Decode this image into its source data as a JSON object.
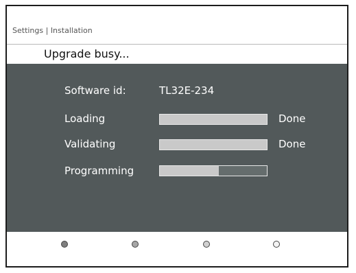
{
  "breadcrumb": "Settings | Installation",
  "title": "Upgrade busy...",
  "software_id": {
    "label": "Software id:",
    "value": "TL32E-234"
  },
  "steps": [
    {
      "label": "Loading",
      "progress": 1.0,
      "status": "Done"
    },
    {
      "label": "Validating",
      "progress": 1.0,
      "status": "Done"
    },
    {
      "label": "Programming",
      "progress": 0.55,
      "status": ""
    }
  ],
  "color_keys": [
    {
      "name": "red-key-icon",
      "fill": "#7f7f7f"
    },
    {
      "name": "green-key-icon",
      "fill": "#a6a6a6"
    },
    {
      "name": "yellow-key-icon",
      "fill": "#d0d0d0"
    },
    {
      "name": "blue-key-icon",
      "fill": "#f4f4f4"
    }
  ],
  "colors": {
    "panel_bg": "#52595a",
    "bar_fill": "#c9c9c9",
    "bar_track": "#656d6d"
  }
}
